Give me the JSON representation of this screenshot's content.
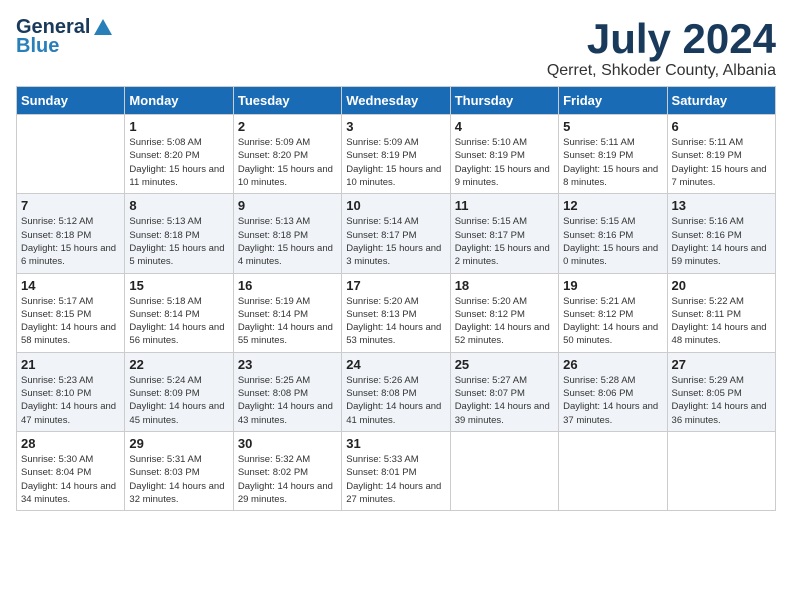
{
  "logo": {
    "general": "General",
    "blue": "Blue"
  },
  "title": "July 2024",
  "location": "Qerret, Shkoder County, Albania",
  "days_of_week": [
    "Sunday",
    "Monday",
    "Tuesday",
    "Wednesday",
    "Thursday",
    "Friday",
    "Saturday"
  ],
  "weeks": [
    [
      {
        "day": "",
        "sunrise": "",
        "sunset": "",
        "daylight": ""
      },
      {
        "day": "1",
        "sunrise": "Sunrise: 5:08 AM",
        "sunset": "Sunset: 8:20 PM",
        "daylight": "Daylight: 15 hours and 11 minutes."
      },
      {
        "day": "2",
        "sunrise": "Sunrise: 5:09 AM",
        "sunset": "Sunset: 8:20 PM",
        "daylight": "Daylight: 15 hours and 10 minutes."
      },
      {
        "day": "3",
        "sunrise": "Sunrise: 5:09 AM",
        "sunset": "Sunset: 8:19 PM",
        "daylight": "Daylight: 15 hours and 10 minutes."
      },
      {
        "day": "4",
        "sunrise": "Sunrise: 5:10 AM",
        "sunset": "Sunset: 8:19 PM",
        "daylight": "Daylight: 15 hours and 9 minutes."
      },
      {
        "day": "5",
        "sunrise": "Sunrise: 5:11 AM",
        "sunset": "Sunset: 8:19 PM",
        "daylight": "Daylight: 15 hours and 8 minutes."
      },
      {
        "day": "6",
        "sunrise": "Sunrise: 5:11 AM",
        "sunset": "Sunset: 8:19 PM",
        "daylight": "Daylight: 15 hours and 7 minutes."
      }
    ],
    [
      {
        "day": "7",
        "sunrise": "Sunrise: 5:12 AM",
        "sunset": "Sunset: 8:18 PM",
        "daylight": "Daylight: 15 hours and 6 minutes."
      },
      {
        "day": "8",
        "sunrise": "Sunrise: 5:13 AM",
        "sunset": "Sunset: 8:18 PM",
        "daylight": "Daylight: 15 hours and 5 minutes."
      },
      {
        "day": "9",
        "sunrise": "Sunrise: 5:13 AM",
        "sunset": "Sunset: 8:18 PM",
        "daylight": "Daylight: 15 hours and 4 minutes."
      },
      {
        "day": "10",
        "sunrise": "Sunrise: 5:14 AM",
        "sunset": "Sunset: 8:17 PM",
        "daylight": "Daylight: 15 hours and 3 minutes."
      },
      {
        "day": "11",
        "sunrise": "Sunrise: 5:15 AM",
        "sunset": "Sunset: 8:17 PM",
        "daylight": "Daylight: 15 hours and 2 minutes."
      },
      {
        "day": "12",
        "sunrise": "Sunrise: 5:15 AM",
        "sunset": "Sunset: 8:16 PM",
        "daylight": "Daylight: 15 hours and 0 minutes."
      },
      {
        "day": "13",
        "sunrise": "Sunrise: 5:16 AM",
        "sunset": "Sunset: 8:16 PM",
        "daylight": "Daylight: 14 hours and 59 minutes."
      }
    ],
    [
      {
        "day": "14",
        "sunrise": "Sunrise: 5:17 AM",
        "sunset": "Sunset: 8:15 PM",
        "daylight": "Daylight: 14 hours and 58 minutes."
      },
      {
        "day": "15",
        "sunrise": "Sunrise: 5:18 AM",
        "sunset": "Sunset: 8:14 PM",
        "daylight": "Daylight: 14 hours and 56 minutes."
      },
      {
        "day": "16",
        "sunrise": "Sunrise: 5:19 AM",
        "sunset": "Sunset: 8:14 PM",
        "daylight": "Daylight: 14 hours and 55 minutes."
      },
      {
        "day": "17",
        "sunrise": "Sunrise: 5:20 AM",
        "sunset": "Sunset: 8:13 PM",
        "daylight": "Daylight: 14 hours and 53 minutes."
      },
      {
        "day": "18",
        "sunrise": "Sunrise: 5:20 AM",
        "sunset": "Sunset: 8:12 PM",
        "daylight": "Daylight: 14 hours and 52 minutes."
      },
      {
        "day": "19",
        "sunrise": "Sunrise: 5:21 AM",
        "sunset": "Sunset: 8:12 PM",
        "daylight": "Daylight: 14 hours and 50 minutes."
      },
      {
        "day": "20",
        "sunrise": "Sunrise: 5:22 AM",
        "sunset": "Sunset: 8:11 PM",
        "daylight": "Daylight: 14 hours and 48 minutes."
      }
    ],
    [
      {
        "day": "21",
        "sunrise": "Sunrise: 5:23 AM",
        "sunset": "Sunset: 8:10 PM",
        "daylight": "Daylight: 14 hours and 47 minutes."
      },
      {
        "day": "22",
        "sunrise": "Sunrise: 5:24 AM",
        "sunset": "Sunset: 8:09 PM",
        "daylight": "Daylight: 14 hours and 45 minutes."
      },
      {
        "day": "23",
        "sunrise": "Sunrise: 5:25 AM",
        "sunset": "Sunset: 8:08 PM",
        "daylight": "Daylight: 14 hours and 43 minutes."
      },
      {
        "day": "24",
        "sunrise": "Sunrise: 5:26 AM",
        "sunset": "Sunset: 8:08 PM",
        "daylight": "Daylight: 14 hours and 41 minutes."
      },
      {
        "day": "25",
        "sunrise": "Sunrise: 5:27 AM",
        "sunset": "Sunset: 8:07 PM",
        "daylight": "Daylight: 14 hours and 39 minutes."
      },
      {
        "day": "26",
        "sunrise": "Sunrise: 5:28 AM",
        "sunset": "Sunset: 8:06 PM",
        "daylight": "Daylight: 14 hours and 37 minutes."
      },
      {
        "day": "27",
        "sunrise": "Sunrise: 5:29 AM",
        "sunset": "Sunset: 8:05 PM",
        "daylight": "Daylight: 14 hours and 36 minutes."
      }
    ],
    [
      {
        "day": "28",
        "sunrise": "Sunrise: 5:30 AM",
        "sunset": "Sunset: 8:04 PM",
        "daylight": "Daylight: 14 hours and 34 minutes."
      },
      {
        "day": "29",
        "sunrise": "Sunrise: 5:31 AM",
        "sunset": "Sunset: 8:03 PM",
        "daylight": "Daylight: 14 hours and 32 minutes."
      },
      {
        "day": "30",
        "sunrise": "Sunrise: 5:32 AM",
        "sunset": "Sunset: 8:02 PM",
        "daylight": "Daylight: 14 hours and 29 minutes."
      },
      {
        "day": "31",
        "sunrise": "Sunrise: 5:33 AM",
        "sunset": "Sunset: 8:01 PM",
        "daylight": "Daylight: 14 hours and 27 minutes."
      },
      {
        "day": "",
        "sunrise": "",
        "sunset": "",
        "daylight": ""
      },
      {
        "day": "",
        "sunrise": "",
        "sunset": "",
        "daylight": ""
      },
      {
        "day": "",
        "sunrise": "",
        "sunset": "",
        "daylight": ""
      }
    ]
  ]
}
